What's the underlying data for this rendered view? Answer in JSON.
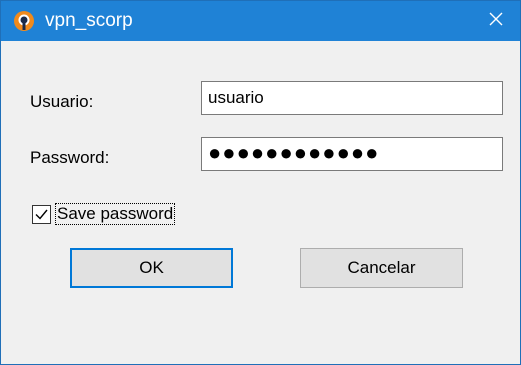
{
  "window": {
    "title": "vpn_scorp",
    "icons": {
      "app": "openvpn-icon",
      "close": "close-icon"
    }
  },
  "form": {
    "username_label": "Usuario:",
    "username_value": "usuario",
    "password_label": "Password:",
    "password_value": "●●●●●●●●●●●●",
    "save_password_label": "Save password",
    "save_password_checked": true
  },
  "buttons": {
    "ok_label": "OK",
    "cancel_label": "Cancelar"
  },
  "colors": {
    "titlebar": "#1f82d6",
    "accent": "#0078d7",
    "icon_orange": "#f08a1c"
  }
}
